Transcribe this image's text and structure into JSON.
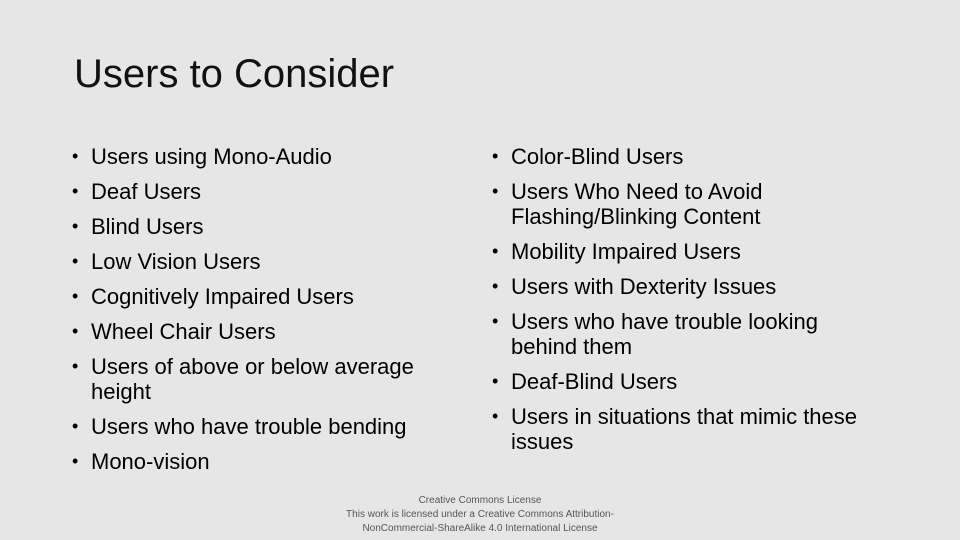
{
  "slide": {
    "title": "Users to Consider",
    "left_list": [
      "Users using Mono-Audio",
      "Deaf Users",
      "Blind Users",
      "Low Vision Users",
      "Cognitively Impaired Users",
      "Wheel Chair Users",
      "Users of above or below average height",
      "Users who have trouble bending",
      "Mono-vision"
    ],
    "right_list": [
      "Color-Blind Users",
      "Users Who Need to Avoid Flashing/Blinking Content",
      "Mobility Impaired Users",
      "Users with Dexterity Issues",
      "Users who have trouble looking behind them",
      "Deaf-Blind Users",
      "Users in situations that mimic these issues"
    ],
    "bullet_glyph": "•"
  },
  "footer": {
    "line1": "Creative Commons License",
    "line2": "This work is licensed under a Creative Commons Attribution-",
    "line3": "NonCommercial-ShareAlike 4.0 International License"
  }
}
